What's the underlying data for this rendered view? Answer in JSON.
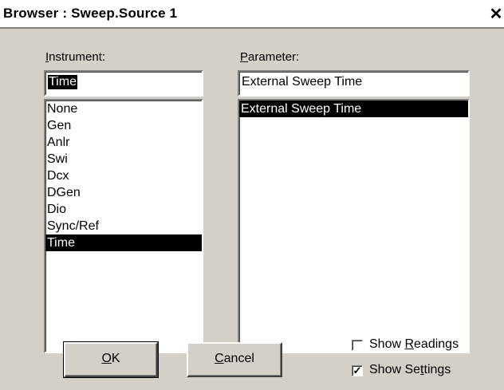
{
  "window": {
    "title": "Browser : Sweep.Source 1",
    "close_glyph": "✕"
  },
  "instrument": {
    "label_mnemonic": "I",
    "label_rest": "nstrument:",
    "value": "Time",
    "items": [
      "None",
      "Gen",
      "Anlr",
      "Swi",
      "Dcx",
      "DGen",
      "Dio",
      "Sync/Ref",
      "Time"
    ],
    "selected_index": 8
  },
  "parameter": {
    "label_mnemonic": "P",
    "label_rest": "arameter:",
    "value": "External Sweep Time",
    "items": [
      "External Sweep Time"
    ],
    "selected_index": 0
  },
  "buttons": {
    "ok_mnemonic": "O",
    "ok_rest": "K",
    "cancel_mnemonic": "C",
    "cancel_rest": "ancel"
  },
  "options": {
    "show_readings_pre": "Show ",
    "show_readings_mnemonic": "R",
    "show_readings_post": "eadings",
    "show_readings_checked": false,
    "show_settings_pre": "Show Se",
    "show_settings_mnemonic": "t",
    "show_settings_post": "tings",
    "show_settings_checked": true,
    "check_glyph": "✓"
  }
}
